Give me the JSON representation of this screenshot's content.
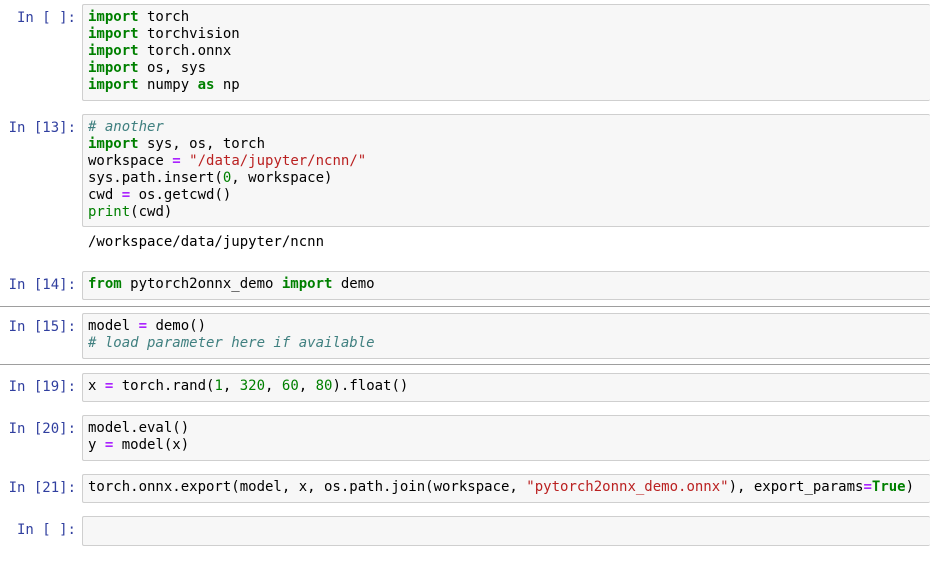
{
  "cells": [
    {
      "prompt": "In [ ]:"
    },
    {
      "prompt": "In [13]:",
      "output": "/workspace/data/jupyter/ncnn"
    },
    {
      "prompt": "In [14]:"
    },
    {
      "prompt": "In [15]:"
    },
    {
      "prompt": "In [19]:"
    },
    {
      "prompt": "In [20]:"
    },
    {
      "prompt": "In [21]:"
    },
    {
      "prompt": "In [ ]:"
    }
  ],
  "code": {
    "c1": [
      "import torch",
      "import torchvision",
      "import torch.onnx",
      "import os, sys",
      "import numpy as np"
    ],
    "c2": [
      "# another",
      "import sys, os, torch",
      "workspace = \"/data/jupyter/ncnn/\"",
      "sys.path.insert(0, workspace)",
      "cwd = os.getcwd()",
      "print(cwd)"
    ],
    "c3": [
      "from pytorch2onnx_demo import demo"
    ],
    "c4": [
      "model = demo()",
      "# load parameter here if available"
    ],
    "c5": [
      "x = torch.rand(1, 320, 60, 80).float()"
    ],
    "c6": [
      "model.eval()",
      "y = model(x)"
    ],
    "c7": [
      "torch.onnx.export(model, x, os.path.join(workspace, \"pytorch2onnx_demo.onnx\"), export_params=True)"
    ]
  },
  "colors": {
    "prompt": "#303f9f",
    "keyword": "#008000",
    "string": "#ba2121",
    "comment": "#408080",
    "operator": "#aa22ff",
    "cell_bg": "#f7f7f7"
  }
}
